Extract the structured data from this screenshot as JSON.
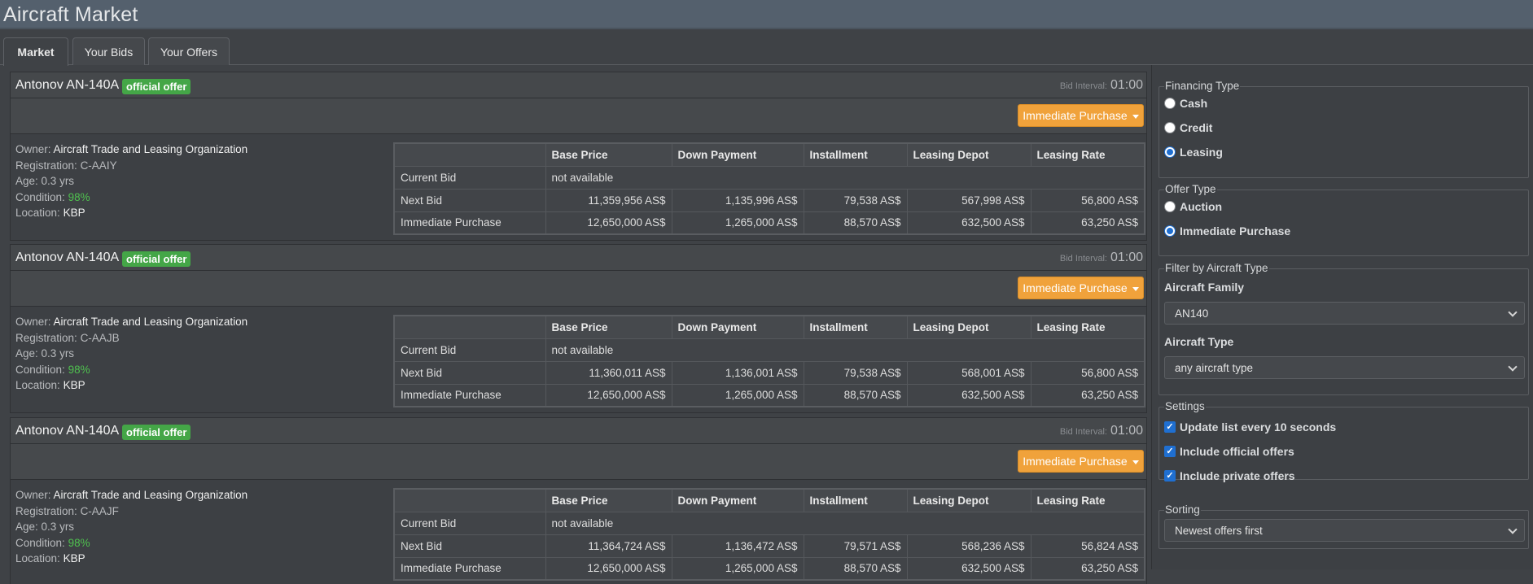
{
  "app": {
    "title": "Aircraft Market"
  },
  "tabs": [
    {
      "label": "Market",
      "active": true
    },
    {
      "label": "Your Bids",
      "active": false
    },
    {
      "label": "Your Offers",
      "active": false
    }
  ],
  "table_headers": [
    "",
    "Base Price",
    "Down Payment",
    "Installment",
    "Leasing Depot",
    "Leasing Rate"
  ],
  "listings": [
    {
      "aircraft": "Antonov AN-140A",
      "badge": "official offer",
      "bid_interval_label": "Bid Interval:",
      "bid_interval_value": "01:00",
      "buy_label": "Immediate Purchase",
      "owner_label": "Owner:",
      "owner": "Aircraft Trade and Leasing Organization",
      "registration_label": "Registration:",
      "registration": "C-AAIY",
      "age_label": "Age:",
      "age": "0.3 yrs",
      "condition_label": "Condition:",
      "condition": "98%",
      "location_label": "Location:",
      "location": "KBP",
      "current_bid_label": "Current Bid",
      "current_bid": "not available",
      "next_bid": {
        "label": "Next Bid",
        "values": [
          "11,359,956 AS$",
          "1,135,996 AS$",
          "79,538 AS$",
          "567,998 AS$",
          "56,800 AS$"
        ]
      },
      "immediate": {
        "label": "Immediate Purchase",
        "values": [
          "12,650,000 AS$",
          "1,265,000 AS$",
          "88,570 AS$",
          "632,500 AS$",
          "63,250 AS$"
        ]
      }
    },
    {
      "aircraft": "Antonov AN-140A",
      "badge": "official offer",
      "bid_interval_label": "Bid Interval:",
      "bid_interval_value": "01:00",
      "buy_label": "Immediate Purchase",
      "owner_label": "Owner:",
      "owner": "Aircraft Trade and Leasing Organization",
      "registration_label": "Registration:",
      "registration": "C-AAJB",
      "age_label": "Age:",
      "age": "0.3 yrs",
      "condition_label": "Condition:",
      "condition": "98%",
      "location_label": "Location:",
      "location": "KBP",
      "current_bid_label": "Current Bid",
      "current_bid": "not available",
      "next_bid": {
        "label": "Next Bid",
        "values": [
          "11,360,011 AS$",
          "1,136,001 AS$",
          "79,538 AS$",
          "568,001 AS$",
          "56,800 AS$"
        ]
      },
      "immediate": {
        "label": "Immediate Purchase",
        "values": [
          "12,650,000 AS$",
          "1,265,000 AS$",
          "88,570 AS$",
          "632,500 AS$",
          "63,250 AS$"
        ]
      }
    },
    {
      "aircraft": "Antonov AN-140A",
      "badge": "official offer",
      "bid_interval_label": "Bid Interval:",
      "bid_interval_value": "01:00",
      "buy_label": "Immediate Purchase",
      "owner_label": "Owner:",
      "owner": "Aircraft Trade and Leasing Organization",
      "registration_label": "Registration:",
      "registration": "C-AAJF",
      "age_label": "Age:",
      "age": "0.3 yrs",
      "condition_label": "Condition:",
      "condition": "98%",
      "location_label": "Location:",
      "location": "KBP",
      "current_bid_label": "Current Bid",
      "current_bid": "not available",
      "next_bid": {
        "label": "Next Bid",
        "values": [
          "11,364,724 AS$",
          "1,136,472 AS$",
          "79,571 AS$",
          "568,236 AS$",
          "56,824 AS$"
        ]
      },
      "immediate": {
        "label": "Immediate Purchase",
        "values": [
          "12,650,000 AS$",
          "1,265,000 AS$",
          "88,570 AS$",
          "632,500 AS$",
          "63,250 AS$"
        ]
      }
    }
  ],
  "sidebar": {
    "financing": {
      "legend": "Financing Type",
      "options": [
        {
          "label": "Cash",
          "selected": false
        },
        {
          "label": "Credit",
          "selected": false
        },
        {
          "label": "Leasing",
          "selected": true
        }
      ]
    },
    "offer_type": {
      "legend": "Offer Type",
      "options": [
        {
          "label": "Auction",
          "selected": false
        },
        {
          "label": "Immediate Purchase",
          "selected": true
        }
      ]
    },
    "filter": {
      "legend": "Filter by Aircraft Type",
      "family_label": "Aircraft Family",
      "family_value": "AN140",
      "type_label": "Aircraft Type",
      "type_value": "any aircraft type"
    },
    "settings": {
      "legend": "Settings",
      "options": [
        {
          "label": "Update list every 10 seconds",
          "checked": true
        },
        {
          "label": "Include official offers",
          "checked": true
        },
        {
          "label": "Include private offers",
          "checked": true
        }
      ]
    },
    "sorting": {
      "legend": "Sorting",
      "value": "Newest offers first"
    }
  },
  "colors": {
    "accent_orange": "#f0a23b",
    "badge_green": "#44a647",
    "condition_green": "#4fc14f",
    "radio_blue": "#1f6fd1"
  }
}
